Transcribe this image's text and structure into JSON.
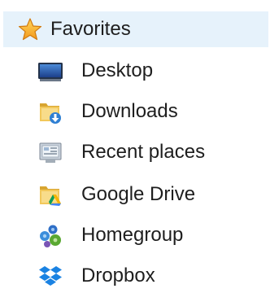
{
  "favorites": {
    "label": "Favorites",
    "icon": "star-icon",
    "items": [
      {
        "label": "Desktop",
        "icon": "desktop-icon"
      },
      {
        "label": "Downloads",
        "icon": "downloads-folder-icon"
      },
      {
        "label": "Recent places",
        "icon": "recent-places-icon"
      },
      {
        "label": "Google Drive",
        "icon": "google-drive-folder-icon"
      },
      {
        "label": "Homegroup",
        "icon": "homegroup-icon"
      },
      {
        "label": "Dropbox",
        "icon": "dropbox-icon"
      }
    ]
  },
  "colors": {
    "header_bg": "#e6f2fb",
    "text": "#1e1e1e",
    "star": "#f5a623",
    "folder": "#e8b84a",
    "dropbox": "#1a82e2"
  }
}
